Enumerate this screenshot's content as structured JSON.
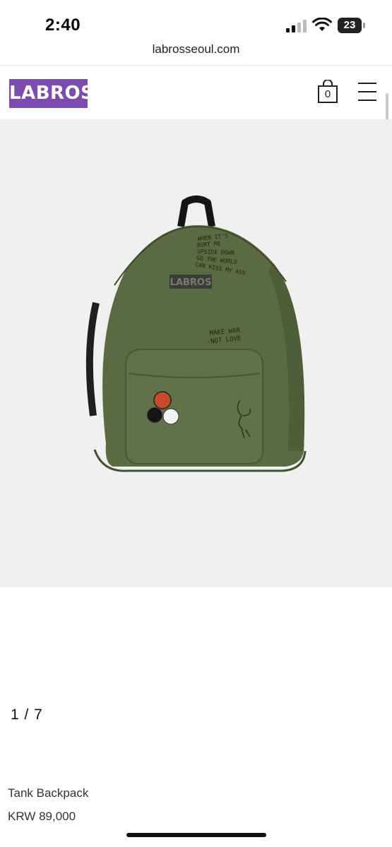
{
  "status_bar": {
    "time": "2:40",
    "battery": "23",
    "icons": [
      "signal-icon",
      "wifi-icon",
      "battery-icon"
    ]
  },
  "browser": {
    "url": "labrosseoul.com"
  },
  "header": {
    "logo_text": "LABROS",
    "logo_color": "#7b4bb0",
    "cart_count": "0",
    "icons": [
      "shopping-bag-icon",
      "hamburger-menu-icon"
    ]
  },
  "product": {
    "image": {
      "bag_label": "LABROS",
      "scribble_lines": [
        "WHEN IT'S",
        "BURT ME",
        "UPSIDE DOWN",
        "GO THE WORLD",
        "CAN KISS MY ASS"
      ],
      "scribble_2": [
        "MAKE WAR",
        "-NOT LOVE"
      ],
      "bag_color": "#5b6a42"
    },
    "gallery_counter": "1 / 7",
    "name": "Tank Backpack",
    "price": "KRW 89,000"
  }
}
